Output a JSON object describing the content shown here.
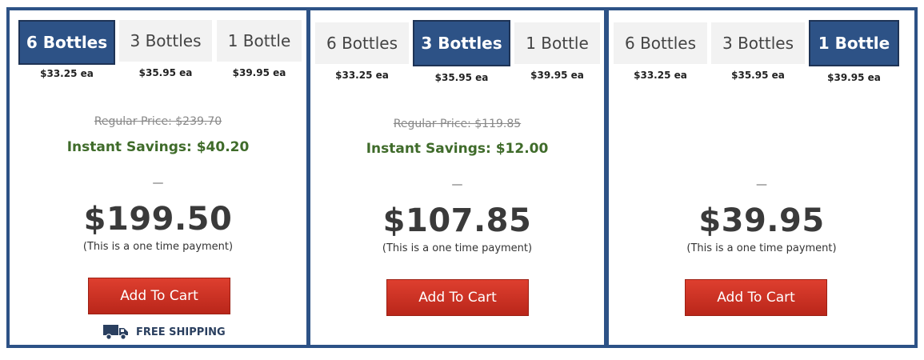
{
  "colors": {
    "accent": "#2d5286",
    "savings": "#3f6b2a",
    "cart": "#c8301f"
  },
  "cards": [
    {
      "options": [
        {
          "label": "6 Bottles",
          "each": "$33.25 ea",
          "selected": true
        },
        {
          "label": "3 Bottles",
          "each": "$35.95 ea",
          "selected": false
        },
        {
          "label": "1 Bottle",
          "each": "$39.95 ea",
          "selected": false
        }
      ],
      "regular_price": "Regular Price: $239.70",
      "savings": "Instant Savings: $40.20",
      "dash": "—",
      "price": "$199.50",
      "note": "(This is a one time payment)",
      "cart_label": "Add To Cart",
      "shipping": "FREE SHIPPING",
      "shipping_icon": "truck-icon"
    },
    {
      "options": [
        {
          "label": "6 Bottles",
          "each": "$33.25 ea",
          "selected": false
        },
        {
          "label": "3 Bottles",
          "each": "$35.95 ea",
          "selected": true
        },
        {
          "label": "1 Bottle",
          "each": "$39.95 ea",
          "selected": false
        }
      ],
      "regular_price": "Regular Price: $119.85",
      "savings": "Instant Savings: $12.00",
      "dash": "—",
      "price": "$107.85",
      "note": "(This is a one time payment)",
      "cart_label": "Add To Cart"
    },
    {
      "options": [
        {
          "label": "6 Bottles",
          "each": "$33.25 ea",
          "selected": false
        },
        {
          "label": "3 Bottles",
          "each": "$35.95 ea",
          "selected": false
        },
        {
          "label": "1 Bottle",
          "each": "$39.95 ea",
          "selected": true
        }
      ],
      "dash": "—",
      "price": "$39.95",
      "note": "(This is a one time payment)",
      "cart_label": "Add To Cart"
    }
  ]
}
